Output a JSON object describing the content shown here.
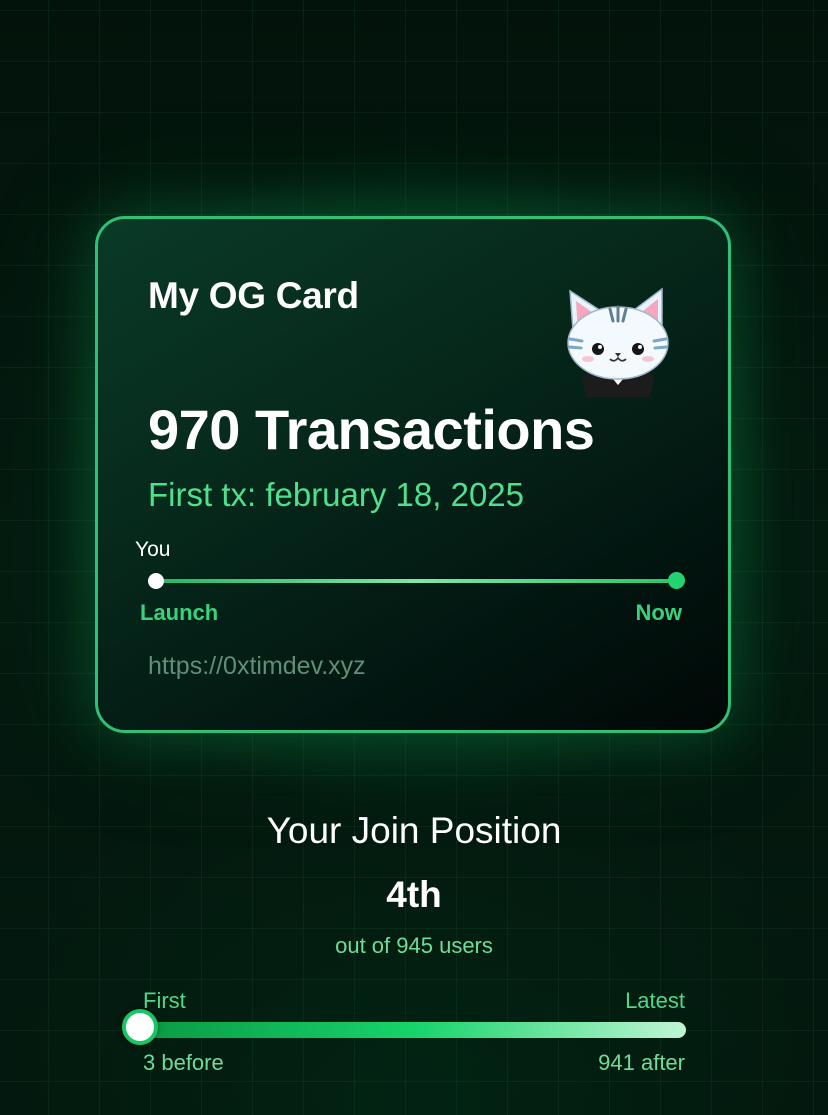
{
  "card": {
    "title": "My OG Card",
    "transactions": "970 Transactions",
    "first_tx": "First tx: february 18, 2025",
    "you_label": "You",
    "timeline": {
      "start_label": "Launch",
      "end_label": "Now",
      "you_position_fraction": 0.0
    },
    "url": "https://0xtimdev.xyz",
    "avatar_icon": "cat-avatar-icon",
    "accent_color": "#2fbf75"
  },
  "join": {
    "title": "Your Join Position",
    "rank": "4th",
    "subtitle": "out of 945 users",
    "range_start_label": "First",
    "range_end_label": "Latest",
    "before_label": "3 before",
    "after_label": "941 after",
    "position_fraction": 0.0
  }
}
